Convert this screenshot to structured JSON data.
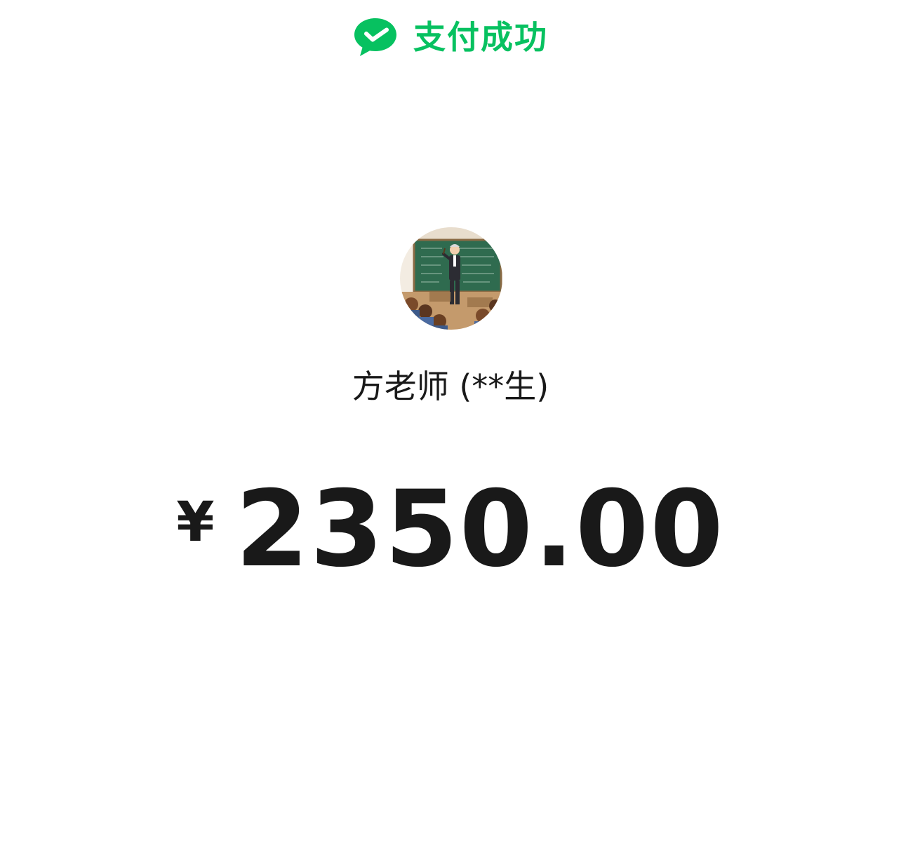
{
  "header": {
    "status_text": "支付成功",
    "icon": "wechat-pay-icon",
    "accent_color": "#07C160"
  },
  "payee": {
    "name": "方老师 (**生)",
    "avatar": "teacher-classroom-avatar"
  },
  "payment": {
    "currency_symbol": "¥",
    "amount": "2350.00"
  }
}
